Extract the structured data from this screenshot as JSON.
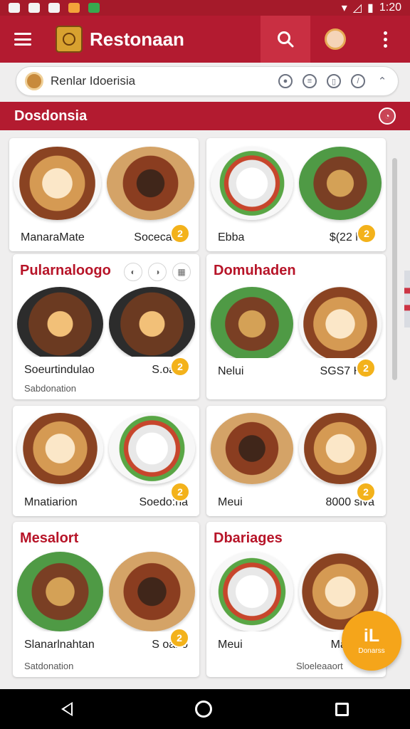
{
  "status_bar": {
    "time": "1:20",
    "icons": [
      "gallery-icon",
      "app-icon",
      "record-icon",
      "orange-app-icon",
      "green-app-icon",
      "wifi-icon",
      "signal-icon",
      "battery-icon"
    ]
  },
  "app_bar": {
    "title": "Restonaan",
    "icons": [
      "hamburger-menu-icon",
      "restaurant-logo-icon",
      "search-icon",
      "profile-avatar-icon",
      "more-options-icon"
    ]
  },
  "search": {
    "query": "Renlar Idoerisia",
    "tool_icons": [
      "voice-icon",
      "filter-icon",
      "bookmark-icon",
      "compass-icon",
      "chevron-icon"
    ]
  },
  "section": {
    "title": "Dosdonsia"
  },
  "cards": [
    {
      "title": "",
      "left": "ManaraMate",
      "right": "Socecaina",
      "badge": "2"
    },
    {
      "title": "",
      "left": "Ebba",
      "right": "$(22 hno",
      "badge": "2"
    },
    {
      "title": "Pularnaloogo",
      "left": "Soeurtindulao",
      "right": "S.oano",
      "sub": "Sabdonation",
      "badge": "2"
    },
    {
      "title": "Domuhaden",
      "left": "Nelui",
      "right": "SGS7 Hn0",
      "badge": "2"
    },
    {
      "title": "",
      "left": "Mnatiarion",
      "right": "Soedo:na",
      "badge": "2"
    },
    {
      "title": "",
      "left": "Meui",
      "right": "8000 slva",
      "badge": "2"
    },
    {
      "title": "Mesalort",
      "left": "Slanarlnahtan",
      "right": "S oano",
      "sub": "Satdonation",
      "badge": "2"
    },
    {
      "title": "Dbariages",
      "left": "Meui",
      "right": "Mareella",
      "sub": "Sloeleaaort",
      "badge": ""
    }
  ],
  "fab": {
    "icon": "iL",
    "label": "Donarss"
  },
  "colors": {
    "primary": "#b31b30",
    "accent": "#f3b21b",
    "fab": "#f5a51a",
    "background": "#efeeee"
  },
  "navigation": [
    "back-nav-icon",
    "home-nav-icon",
    "recents-nav-icon"
  ]
}
